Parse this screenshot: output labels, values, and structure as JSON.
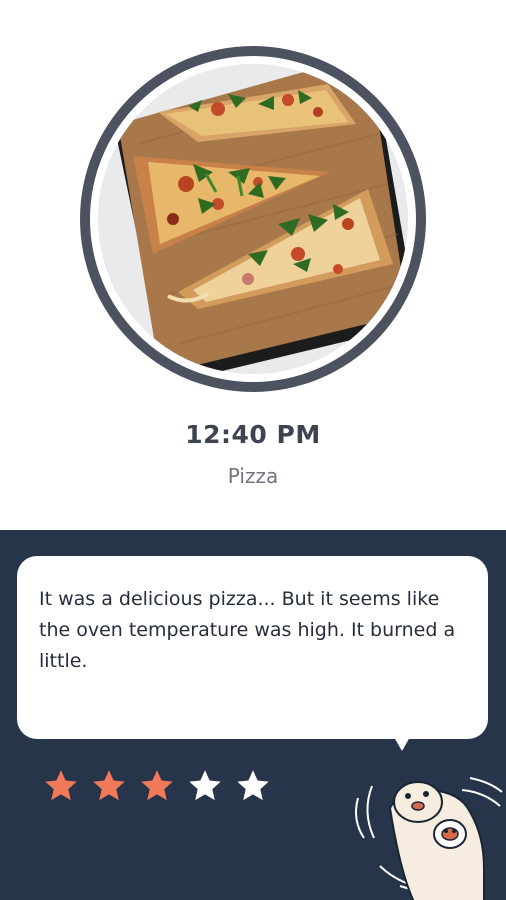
{
  "entry": {
    "time": "12:40 PM",
    "food": "Pizza",
    "photo_icon": "pizza-photo"
  },
  "review": {
    "comment": "It was a delicious pizza... But it seems like the oven temperature was high. It burned a little.",
    "rating": 3,
    "max_rating": 5,
    "star_icon": "star-icon",
    "mascot_icon": "otter-mascot-icon"
  },
  "colors": {
    "ring": "#4c5260",
    "panel": "#263549",
    "star_filled": "#f0795a",
    "star_empty": "#ffffff",
    "time_text": "#3d4350"
  }
}
